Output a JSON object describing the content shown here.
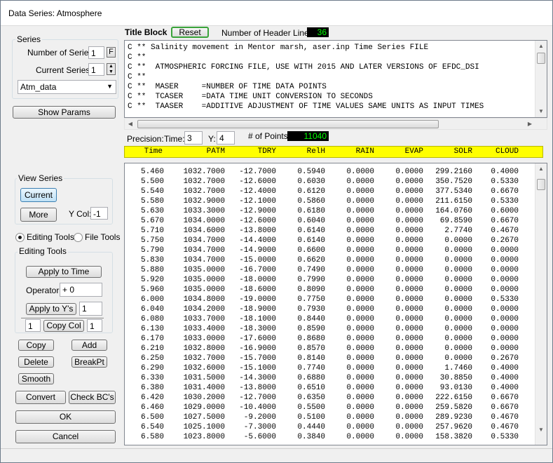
{
  "window": {
    "title": "Data Series: Atmosphere"
  },
  "series": {
    "group_label": "Series",
    "num_label": "Number of Series:",
    "num_value": "1",
    "f_button": "F",
    "current_label": "Current Series:",
    "current_value": "1",
    "dropdown_value": "Atm_data"
  },
  "show_params": "Show Params",
  "view_series": {
    "group_label": "View Series",
    "current_button": "Current",
    "more_button": "More",
    "ycol_label": "Y Col:",
    "ycol_value": "-1"
  },
  "tools": {
    "editing_label": "Editing Tools",
    "file_label": "File Tools",
    "group_label": "Editing Tools",
    "apply_time": "Apply to Time",
    "operator_label": "Operator:",
    "operator_value": "+ 0",
    "apply_ys": "Apply to Y's",
    "apply_ys_value": "1",
    "copy_col_left": "1",
    "copy_col": "Copy Col",
    "copy_col_right": "1",
    "copy": "Copy",
    "add": "Add",
    "delete": "Delete",
    "breakpt": "BreakPt",
    "smooth": "Smooth"
  },
  "bottom": {
    "convert": "Convert",
    "check_bcs": "Check BC's",
    "ok": "OK",
    "cancel": "Cancel"
  },
  "title_block": {
    "label": "Title Block",
    "reset": "Reset",
    "header_lines_label": "Number of Header Lines:",
    "header_lines_value": "36",
    "lines": [
      "C ** Salinity movement in Mentor marsh, aser.inp Time Series FILE",
      "C **",
      "C **  ATMOSPHERIC FORCING FILE, USE WITH 2015 AND LATER VERSIONS OF EFDC_DSI",
      "C **",
      "C **  MASER     =NUMBER OF TIME DATA POINTS",
      "C **  TCASER    =DATA TIME UNIT CONVERSION TO SECONDS",
      "C **  TAASER    =ADDITIVE ADJUSTMENT OF TIME VALUES SAME UNITS AS INPUT TIMES"
    ]
  },
  "precision": {
    "label": "Precision:",
    "time_label": "Time:",
    "time_value": "3",
    "y_label": "Y:",
    "y_value": "4",
    "points_label": "# of Points:",
    "points_value": "11040"
  },
  "table": {
    "columns": [
      "Time",
      "PATM",
      "TDRY",
      "RelH",
      "RAIN",
      "EVAP",
      "SOLR",
      "CLOUD"
    ],
    "rows": [
      [
        "5.460",
        "1032.7000",
        "-12.7000",
        "0.5940",
        "0.0000",
        "0.0000",
        "299.2160",
        "0.4000"
      ],
      [
        "5.500",
        "1032.7000",
        "-12.6000",
        "0.6030",
        "0.0000",
        "0.0000",
        "350.7520",
        "0.5330"
      ],
      [
        "5.540",
        "1032.7000",
        "-12.4000",
        "0.6120",
        "0.0000",
        "0.0000",
        "377.5340",
        "0.6670"
      ],
      [
        "5.580",
        "1032.9000",
        "-12.1000",
        "0.5860",
        "0.0000",
        "0.0000",
        "211.6150",
        "0.5330"
      ],
      [
        "5.630",
        "1033.3000",
        "-12.9000",
        "0.6180",
        "0.0000",
        "0.0000",
        "164.0760",
        "0.6000"
      ],
      [
        "5.670",
        "1034.0000",
        "-12.6000",
        "0.6040",
        "0.0000",
        "0.0000",
        "69.8590",
        "0.6670"
      ],
      [
        "5.710",
        "1034.6000",
        "-13.8000",
        "0.6140",
        "0.0000",
        "0.0000",
        "2.7740",
        "0.4670"
      ],
      [
        "5.750",
        "1034.7000",
        "-14.4000",
        "0.6140",
        "0.0000",
        "0.0000",
        "0.0000",
        "0.2670"
      ],
      [
        "5.790",
        "1034.7000",
        "-14.9000",
        "0.6600",
        "0.0000",
        "0.0000",
        "0.0000",
        "0.0000"
      ],
      [
        "5.830",
        "1034.7000",
        "-15.0000",
        "0.6620",
        "0.0000",
        "0.0000",
        "0.0000",
        "0.0000"
      ],
      [
        "5.880",
        "1035.0000",
        "-16.7000",
        "0.7490",
        "0.0000",
        "0.0000",
        "0.0000",
        "0.0000"
      ],
      [
        "5.920",
        "1035.0000",
        "-18.0000",
        "0.7990",
        "0.0000",
        "0.0000",
        "0.0000",
        "0.0000"
      ],
      [
        "5.960",
        "1035.0000",
        "-18.6000",
        "0.8090",
        "0.0000",
        "0.0000",
        "0.0000",
        "0.0000"
      ],
      [
        "6.000",
        "1034.8000",
        "-19.0000",
        "0.7750",
        "0.0000",
        "0.0000",
        "0.0000",
        "0.5330"
      ],
      [
        "6.040",
        "1034.2000",
        "-18.9000",
        "0.7930",
        "0.0000",
        "0.0000",
        "0.0000",
        "0.0000"
      ],
      [
        "6.080",
        "1033.7000",
        "-18.1000",
        "0.8440",
        "0.0000",
        "0.0000",
        "0.0000",
        "0.0000"
      ],
      [
        "6.130",
        "1033.4000",
        "-18.3000",
        "0.8590",
        "0.0000",
        "0.0000",
        "0.0000",
        "0.0000"
      ],
      [
        "6.170",
        "1033.0000",
        "-17.6000",
        "0.8680",
        "0.0000",
        "0.0000",
        "0.0000",
        "0.0000"
      ],
      [
        "6.210",
        "1032.8000",
        "-16.9000",
        "0.8570",
        "0.0000",
        "0.0000",
        "0.0000",
        "0.0000"
      ],
      [
        "6.250",
        "1032.7000",
        "-15.7000",
        "0.8140",
        "0.0000",
        "0.0000",
        "0.0000",
        "0.2670"
      ],
      [
        "6.290",
        "1032.6000",
        "-15.1000",
        "0.7740",
        "0.0000",
        "0.0000",
        "1.7460",
        "0.4000"
      ],
      [
        "6.330",
        "1031.5000",
        "-14.3000",
        "0.6880",
        "0.0000",
        "0.0000",
        "30.8850",
        "0.4000"
      ],
      [
        "6.380",
        "1031.4000",
        "-13.8000",
        "0.6510",
        "0.0000",
        "0.0000",
        "93.0130",
        "0.4000"
      ],
      [
        "6.420",
        "1030.2000",
        "-12.7000",
        "0.6350",
        "0.0000",
        "0.0000",
        "222.6150",
        "0.6670"
      ],
      [
        "6.460",
        "1029.0000",
        "-10.4000",
        "0.5500",
        "0.0000",
        "0.0000",
        "259.5820",
        "0.6670"
      ],
      [
        "6.500",
        "1027.5000",
        "-9.2000",
        "0.5100",
        "0.0000",
        "0.0000",
        "289.9230",
        "0.4670"
      ],
      [
        "6.540",
        "1025.1000",
        "-7.3000",
        "0.4440",
        "0.0000",
        "0.0000",
        "257.9620",
        "0.4670"
      ],
      [
        "6.580",
        "1023.8000",
        "-5.6000",
        "0.3840",
        "0.0000",
        "0.0000",
        "158.3820",
        "0.5330"
      ]
    ]
  }
}
